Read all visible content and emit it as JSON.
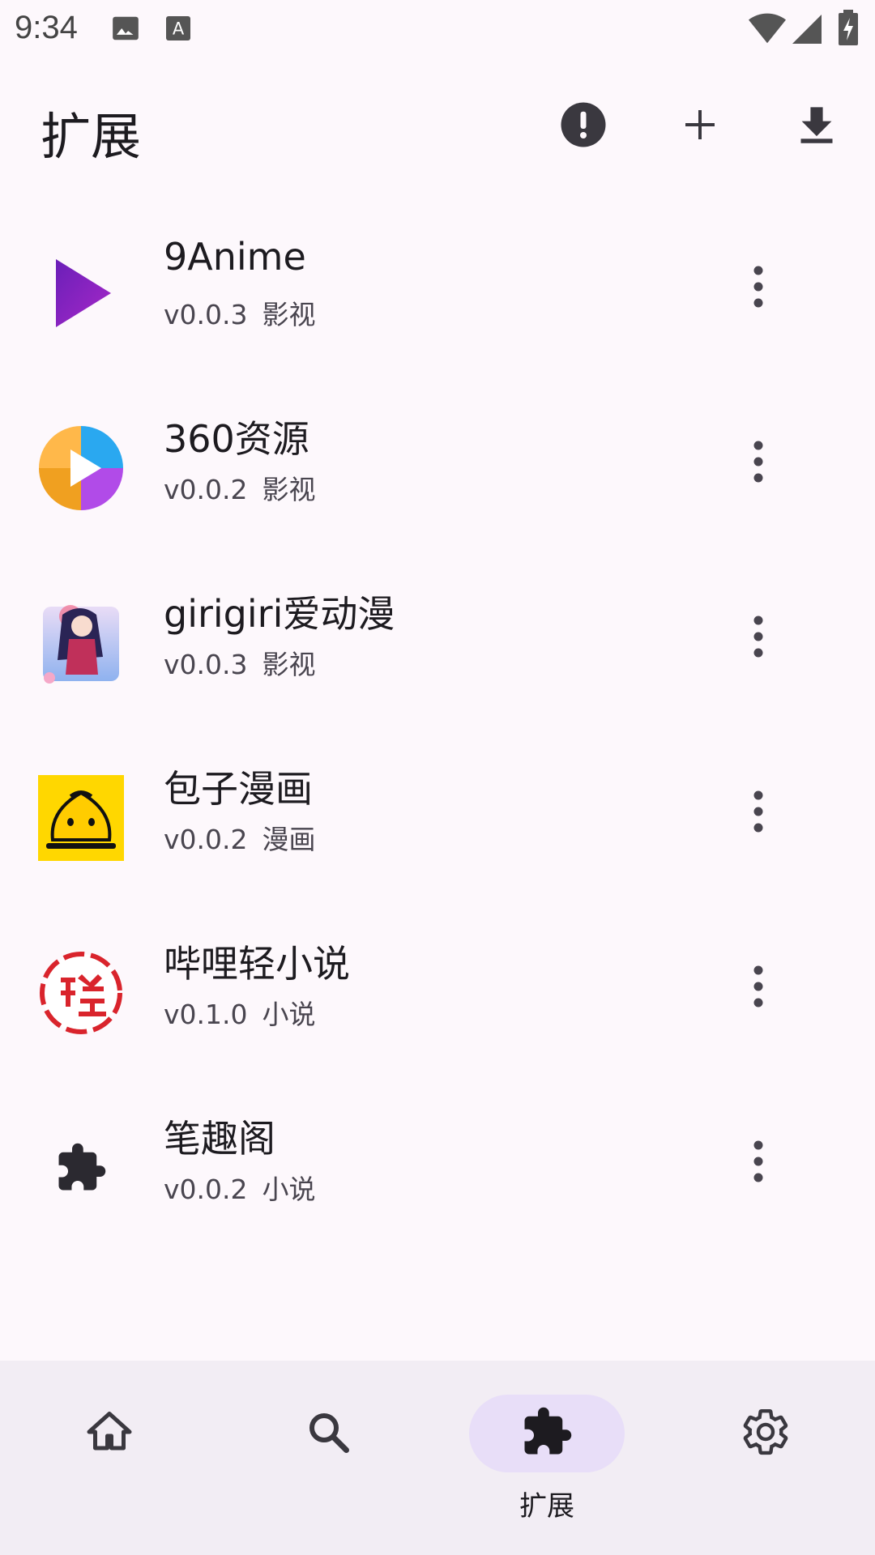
{
  "status_bar": {
    "time": "9:34",
    "icons": [
      "image-icon",
      "text-a-icon",
      "wifi-icon",
      "signal-icon",
      "battery-charging-icon"
    ]
  },
  "app_bar": {
    "title": "扩展",
    "actions": [
      "alert-icon",
      "add-icon",
      "download-icon"
    ]
  },
  "extensions": [
    {
      "name": "9Anime",
      "version": "v0.0.3",
      "category": "影视",
      "icon": "play-triangle-icon"
    },
    {
      "name": "360资源",
      "version": "v0.0.2",
      "category": "影视",
      "icon": "360-play-icon"
    },
    {
      "name": "girigiri爱动漫",
      "version": "v0.0.3",
      "category": "影视",
      "icon": "anime-girl-icon"
    },
    {
      "name": "包子漫画",
      "version": "v0.0.2",
      "category": "漫画",
      "icon": "bun-icon"
    },
    {
      "name": "哔哩轻小说",
      "version": "v0.1.0",
      "category": "小说",
      "icon": "light-novel-icon"
    },
    {
      "name": "笔趣阁",
      "version": "v0.0.2",
      "category": "小说",
      "icon": "puzzle-icon"
    }
  ],
  "bottom_nav": {
    "items": [
      {
        "icon": "home-icon",
        "label": ""
      },
      {
        "icon": "search-icon",
        "label": ""
      },
      {
        "icon": "puzzle-icon",
        "label": "扩展",
        "active": true
      },
      {
        "icon": "settings-icon",
        "label": ""
      }
    ]
  },
  "colors": {
    "background": "#fdf8fc",
    "nav_background": "#f2edf4",
    "nav_active_pill": "#e8def8",
    "text_primary": "#1d1b20",
    "text_secondary": "#49454f",
    "accent_purple": "#8b22c4"
  }
}
